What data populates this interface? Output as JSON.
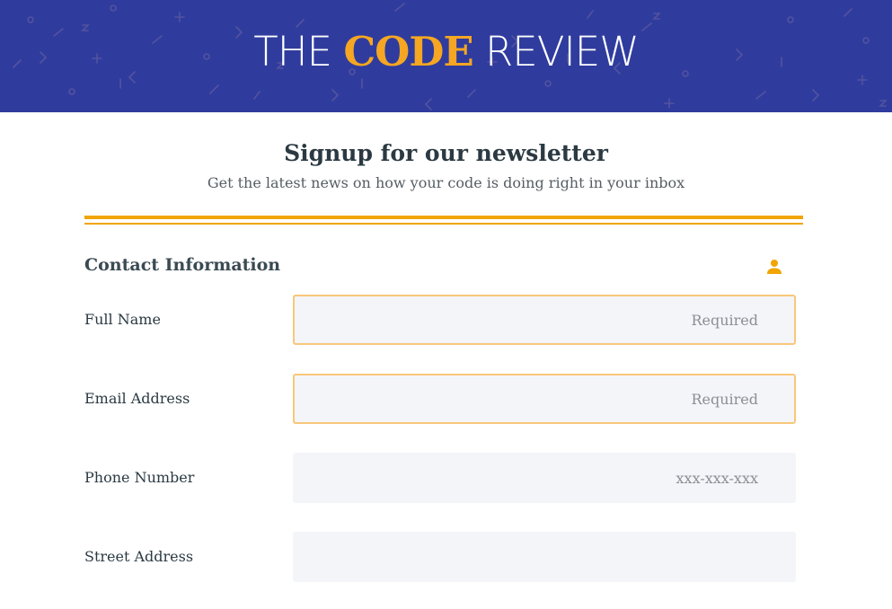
{
  "header": {
    "title_pre": "THE ",
    "title_accent": "CODE",
    "title_post": " REVIEW"
  },
  "intro": {
    "title": "Signup for our newsletter",
    "subtitle": "Get the latest news on how your code is doing right in your inbox"
  },
  "section": {
    "title": "Contact Information",
    "icon": "person-icon"
  },
  "fields": [
    {
      "label": "Full Name",
      "value": "",
      "placeholder": "Required"
    },
    {
      "label": "Email Address",
      "value": "",
      "placeholder": "Required"
    },
    {
      "label": "Phone Number",
      "value": "",
      "placeholder": "xxx-xxx-xxx"
    },
    {
      "label": "Street Address",
      "value": "",
      "placeholder": ""
    }
  ],
  "colors": {
    "banner_bg": "#2f3c9e",
    "accent": "#f5a623",
    "rule": "#f0a500",
    "required_border": "#f8c77a",
    "input_bg": "#f4f5f9"
  }
}
